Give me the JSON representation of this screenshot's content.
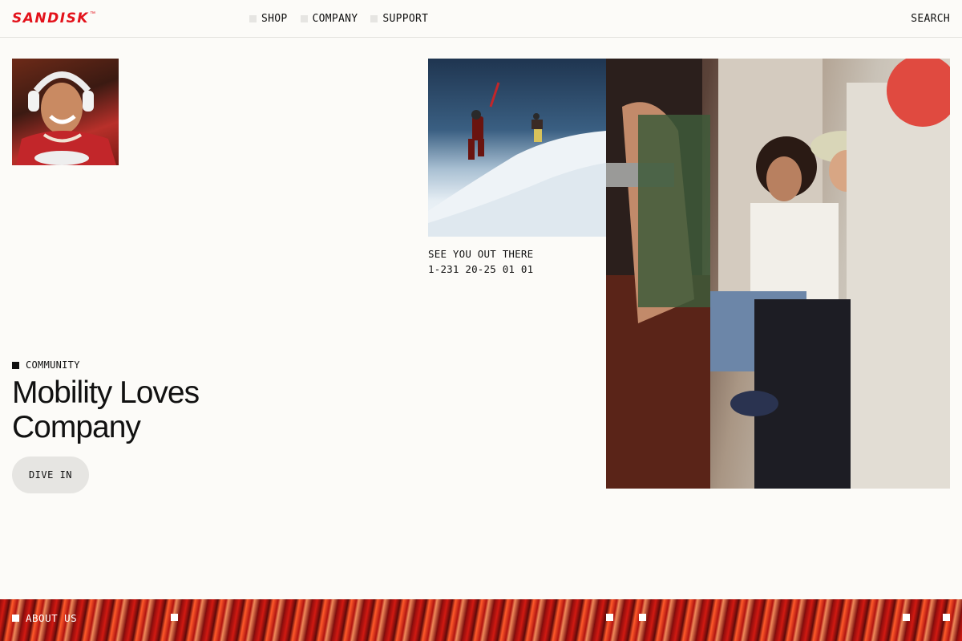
{
  "brand": {
    "name": "SANDISK",
    "trademark": "™",
    "color": "#e3121b"
  },
  "nav": {
    "items": [
      {
        "label": "SHOP"
      },
      {
        "label": "COMPANY"
      },
      {
        "label": "SUPPORT"
      }
    ],
    "search_label": "SEARCH"
  },
  "hero": {
    "caption_line1": "SEE YOU OUT THERE",
    "caption_line2": "1-231 20-25 01 01",
    "tag_label": "COMMUNITY",
    "headline_line1": "Mobility Loves",
    "headline_line2": "Company",
    "cta_label": "DIVE IN"
  },
  "footer": {
    "label": "ABOUT US"
  }
}
